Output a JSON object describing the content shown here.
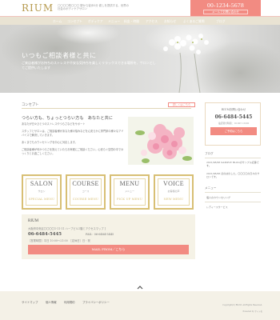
{
  "header": {
    "logo": "RIUM",
    "tagline": "〇〇〇〇県〇〇〇 駅から徒歩5分 癒しを提供する、世界の社会のボディケアサロン",
    "tel": "00-1234-5678",
    "mail_button": "メールでお問い合わせ"
  },
  "nav": {
    "items": [
      "ホーム",
      "コンセプト",
      "ボディケア",
      "メニュー",
      "料金・時間",
      "アクセス",
      "お知らせ",
      "よくあるご質問",
      "ブログ"
    ]
  },
  "hero": {
    "title": "いつもご相談者様と共に",
    "subtitle": "ご来店者様がお持ちのストレスや不安な気持ちを楽しくリラックスできる場所を、サロンとしてご提供いたします"
  },
  "concept": {
    "section_title": "コンセプト",
    "more_button": "詳しくはこちら",
    "headline": "つらい方も、ちょっとつらい方も　あなたと共に",
    "paragraphs": [
      "あなたが日々ひとつのストレスやつらさなどをサポート",
      "スタッフとサロンは、ご相談者様があなた様の悩みなどを心安らかに専門家の様々なアドバイスで解決していきます。",
      "あくまでもカウンセリングを中心に対応します。",
      "ご相談者様が何かつらさを抱えていたらお気軽にご相談ください。心安らぐ空間の中でゆっくりとお過ごしください。"
    ]
  },
  "menu_boxes": [
    {
      "title": "SALON",
      "jp": "サロン",
      "sub": "SPECIAL MENU"
    },
    {
      "title": "COURSE",
      "jp": "コース",
      "sub": "COURSE MENU"
    },
    {
      "title": "MENU",
      "jp": "メニュー",
      "sub": "PICK UP MENU"
    },
    {
      "title": "VOICE",
      "jp": "お客様の声",
      "sub": "NEW MENU"
    }
  ],
  "info": {
    "name": "RIUM",
    "address": "大阪府中央区〇〇〇〇1-11-11 ハーブビル1階 [ アクセスマップ ]",
    "tel": "06-6484-5445",
    "fax": "FAX：06-6484-5445",
    "hours": "［営業時間］平日 10:00～21:00　［定休日］日・祝",
    "button": "MAIL FROM／こちら"
  },
  "sidebar": {
    "box_title": "RIUMお問い合わせ",
    "tel": "06-6484-5445",
    "hours": "電話受付時間：10:00～19:00",
    "mail_button": "ご予約はこちら",
    "blog_heading": "ブログ",
    "blog_items": [
      "2021/08/06 SAMPLE BLOGのサンプル記事です。",
      "2021/08/06 ほのぼのした。〇〇〇〇の日々のサロンです。"
    ],
    "menu_heading": "メニュー",
    "menu_items": [
      "個人のカウンセリング",
      "レディース"
    ],
    "extra_items": [
      "レディースサービス"
    ]
  },
  "footer": {
    "links": [
      "サイトマップ",
      "個人情報",
      "利用規約",
      "プライバシーポリシー"
    ],
    "copyright": "Copyright(C) RIUM. All Rights Reserved.",
    "powered": "Powered by サイト名"
  },
  "colors": {
    "accent": "#f28b82",
    "gold": "#d8bf74",
    "nav_bg": "#e9e3d3",
    "footer_bg": "#f4f1e7"
  }
}
